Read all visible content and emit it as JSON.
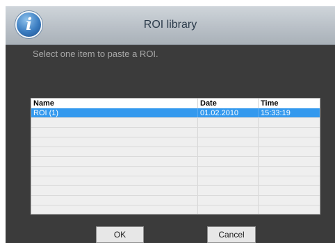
{
  "dialog": {
    "title": "ROI library",
    "info_icon": "info-icon",
    "prompt": "Select one item to paste a ROI."
  },
  "list": {
    "columns": [
      "Name",
      "Date",
      "Time"
    ],
    "rows": [
      [
        "ROI (1)",
        "01.02.2010",
        "15:33:19"
      ],
      [
        "",
        "",
        ""
      ],
      [
        "",
        "",
        ""
      ],
      [
        "",
        "",
        ""
      ],
      [
        "",
        "",
        ""
      ],
      [
        "",
        "",
        ""
      ],
      [
        "",
        "",
        ""
      ],
      [
        "",
        "",
        ""
      ],
      [
        "",
        "",
        ""
      ],
      [
        "",
        "",
        ""
      ],
      [
        "",
        "",
        ""
      ]
    ],
    "selected_index": 0
  },
  "buttons": {
    "ok_label": "OK",
    "cancel_label": "Cancel"
  },
  "colors": {
    "dialog_background": "#3b3b3b",
    "selection": "#3399ee",
    "title_text": "#2a3a4a"
  }
}
